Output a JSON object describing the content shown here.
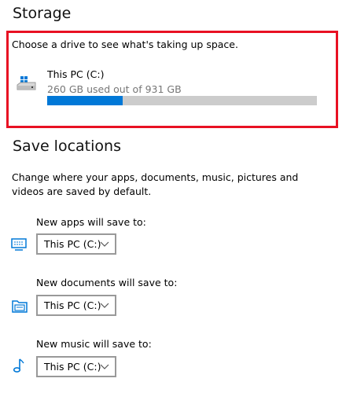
{
  "storage": {
    "title": "Storage",
    "prompt": "Choose a drive to see what's taking up space.",
    "drive": {
      "name": "This PC (C:)",
      "usage_text": "260 GB used out of 931 GB",
      "used_fraction": 0.279
    }
  },
  "save_locations": {
    "title": "Save locations",
    "description": "Change where your apps, documents, music, pictures and videos are saved by default.",
    "items": [
      {
        "label": "New apps will save to:",
        "value": "This PC (C:)",
        "icon": "monitor-icon"
      },
      {
        "label": "New documents will save to:",
        "value": "This PC (C:)",
        "icon": "folder-icon"
      },
      {
        "label": "New music will save to:",
        "value": "This PC (C:)",
        "icon": "music-note-icon"
      }
    ]
  },
  "watermark": "",
  "colors": {
    "accent": "#0078d7",
    "highlight": "#e81123",
    "track": "#cccccc"
  }
}
